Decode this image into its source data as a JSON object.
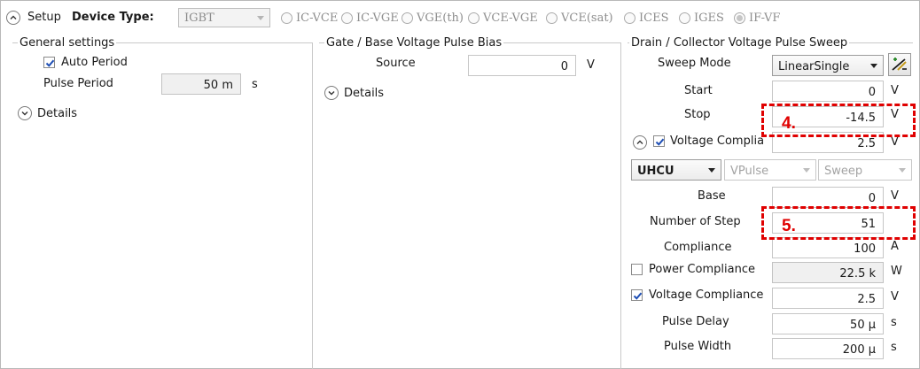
{
  "header": {
    "setup_label": "Setup",
    "device_type_label": "Device Type:",
    "device_type_value": "IGBT",
    "radio_options": [
      "IC-VCE",
      "IC-VGE",
      "VGE(th)",
      "VCE-VGE",
      "VCE(sat)",
      "ICES",
      "IGES",
      "IF-VF"
    ],
    "selected_option": "IF-VF"
  },
  "general": {
    "title": "General settings",
    "auto_period_label": "Auto Period",
    "auto_period_checked": true,
    "pulse_period_label": "Pulse Period",
    "pulse_period_value": "50 m",
    "pulse_period_unit": "s",
    "details_label": "Details"
  },
  "gate": {
    "title": "Gate / Base Voltage Pulse Bias",
    "source_label": "Source",
    "source_value": "0",
    "source_unit": "V",
    "details_label": "Details"
  },
  "drain": {
    "title": "Drain / Collector Voltage Pulse Sweep",
    "sweep_mode_label": "Sweep Mode",
    "sweep_mode_value": "LinearSingle",
    "start_label": "Start",
    "start_value": "0",
    "start_unit": "V",
    "stop_label": "Stop",
    "stop_value": "-14.5",
    "stop_unit": "V",
    "voltage_compliance_short_label": "Voltage Complia",
    "voltage_compliance_short_value": "2.5",
    "voltage_compliance_short_unit": "V",
    "unit_select": "UHCU",
    "pulse_select": "VPulse",
    "mode_select": "Sweep",
    "base_label": "Base",
    "base_value": "0",
    "base_unit": "V",
    "steps_label": "Number of Step",
    "steps_value": "51",
    "compliance_label": "Compliance",
    "compliance_value": "100",
    "compliance_unit": "A",
    "power_compliance_label": "Power Compliance",
    "power_compliance_value": "22.5 k",
    "power_compliance_unit": "W",
    "voltage_compliance_label": "Voltage Compliance",
    "voltage_compliance_value": "2.5",
    "voltage_compliance_unit": "V",
    "pulse_delay_label": "Pulse Delay",
    "pulse_delay_value": "50 μ",
    "pulse_delay_unit": "s",
    "pulse_width_label": "Pulse Width",
    "pulse_width_value": "200 μ",
    "pulse_width_unit": "s"
  },
  "annotations": {
    "callout_4": "4.",
    "callout_5": "5."
  },
  "colors": {
    "callout": "#e00000",
    "check": "#1f4fb5"
  }
}
